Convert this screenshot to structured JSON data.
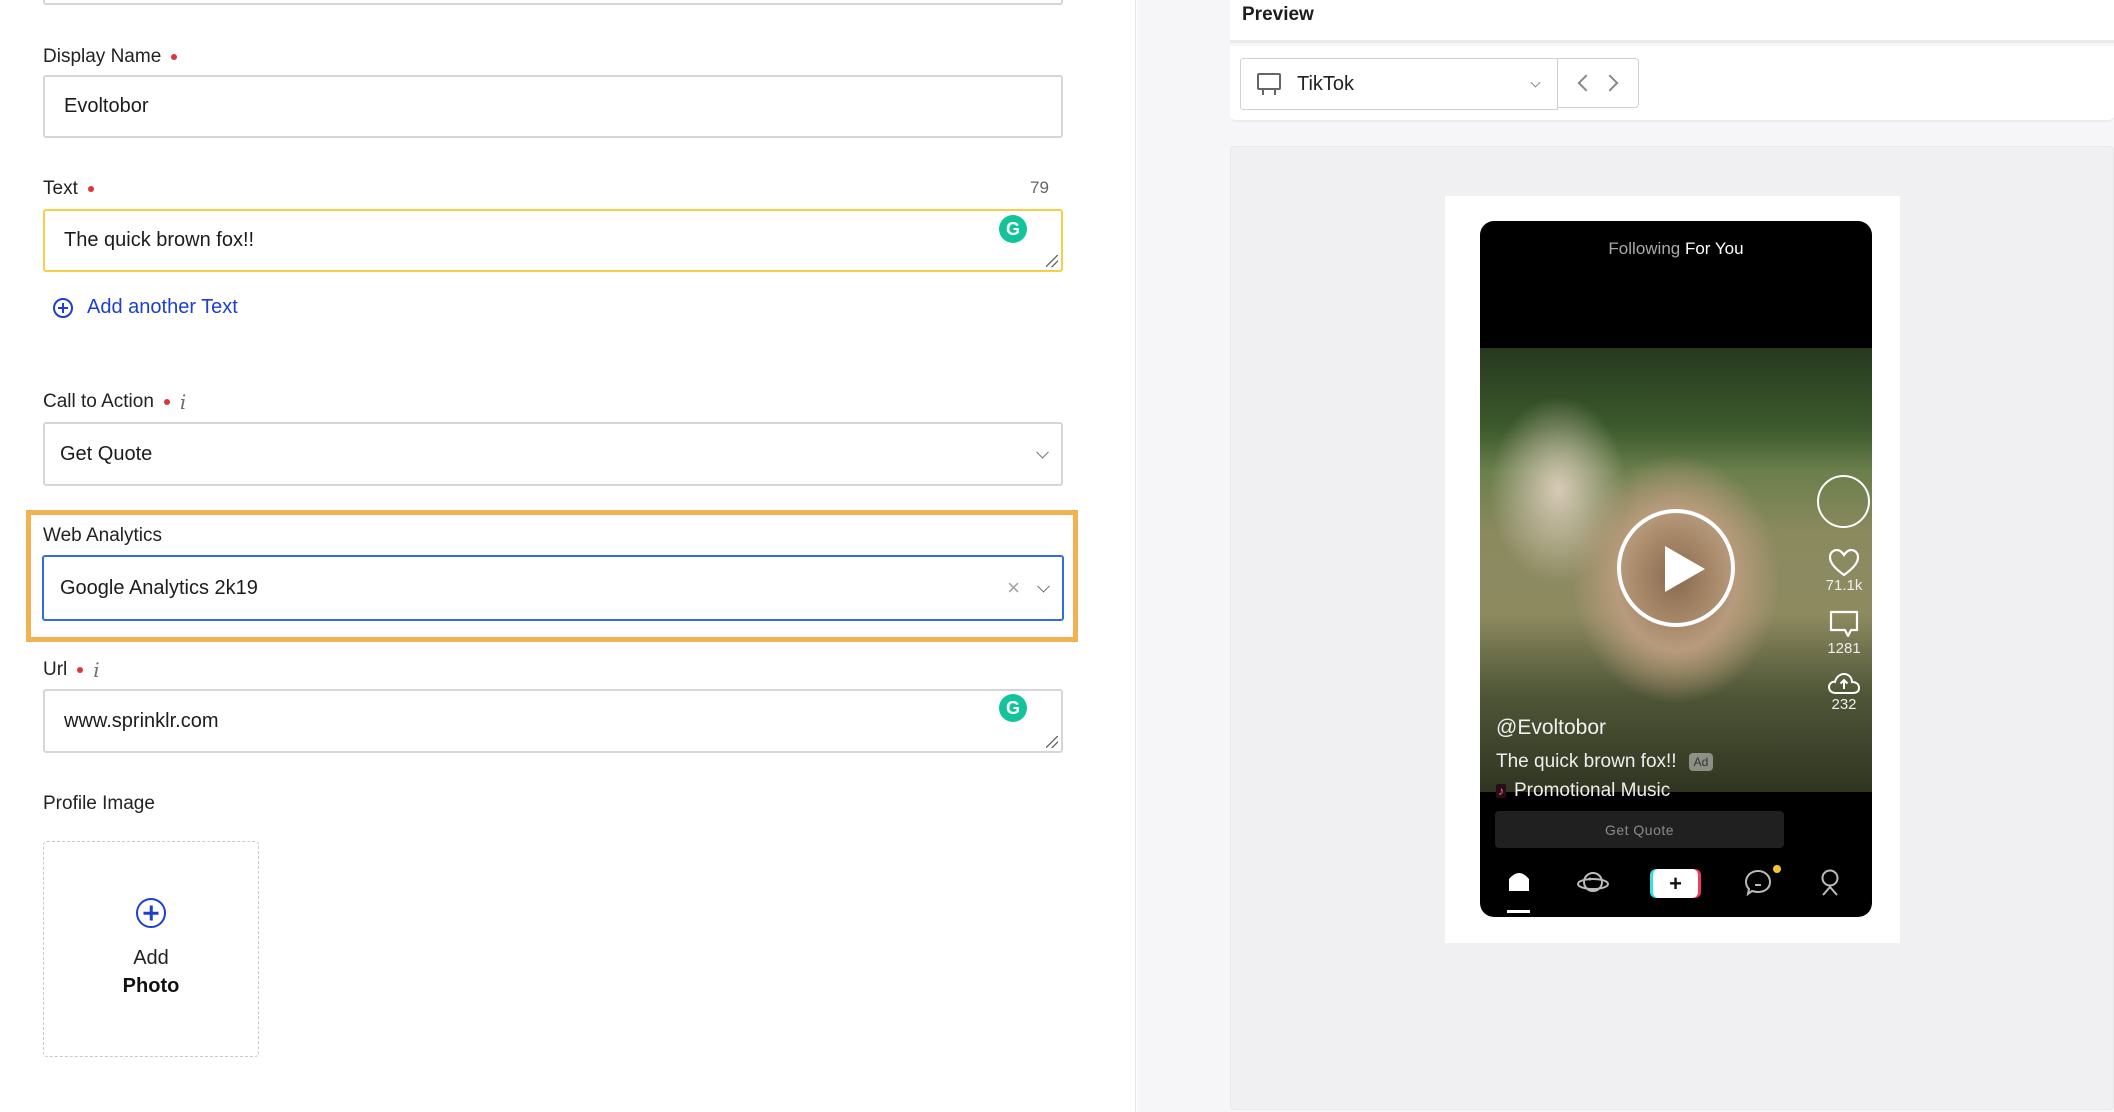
{
  "form": {
    "display_name": {
      "label": "Display Name",
      "required": true,
      "value": "Evoltobor"
    },
    "text": {
      "label": "Text",
      "required": true,
      "value": "The quick brown fox!!",
      "char_count": "79"
    },
    "add_text_link": "Add another Text",
    "call_to_action": {
      "label": "Call to Action",
      "required": true,
      "info": "i",
      "value": "Get Quote"
    },
    "web_analytics": {
      "label": "Web Analytics",
      "value": "Google Analytics 2k19",
      "clear_icon": "×"
    },
    "url": {
      "label": "Url",
      "required": true,
      "info": "i",
      "value": "www.sprinklr.com"
    },
    "profile_image": {
      "label": "Profile Image",
      "add_line1": "Add",
      "add_line2": "Photo"
    },
    "grammarly_glyph": "G"
  },
  "preview": {
    "title": "Preview",
    "channel": "TikTok",
    "phone": {
      "tab_following": "Following",
      "tab_for_you": "For You",
      "username": "@Evoltobor",
      "caption": "The quick brown fox!!",
      "ad_badge": "Ad",
      "music": "Promotional Music",
      "music_icon": "♪",
      "likes": "71.1k",
      "comments": "1281",
      "shares": "232",
      "cta_button": "Get Quote",
      "create_glyph": "+"
    }
  },
  "colors": {
    "highlight": "#f2b152",
    "focus_border": "#2f6de1",
    "link": "#1c3fcf",
    "required": "#d9363e",
    "grammarly": "#15c39a",
    "text_field_border_active": "#f5cf47"
  }
}
